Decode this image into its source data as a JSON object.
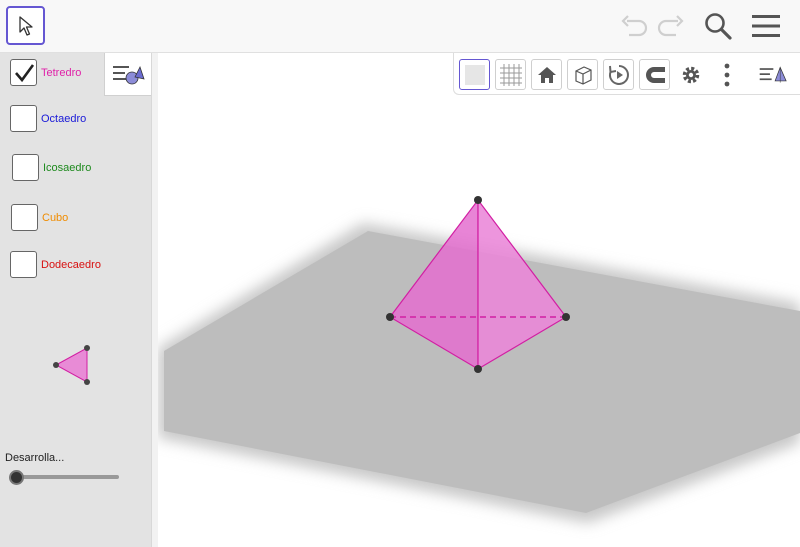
{
  "toolbar": {
    "move_tool": "move-tool",
    "undo": "undo-icon",
    "redo": "redo-icon",
    "search": "search-icon",
    "menu": "menu-icon"
  },
  "algebra": {
    "items": [
      {
        "label": "Tetredro",
        "checked": true,
        "color": "#e020a8"
      },
      {
        "label": "Octaedro",
        "checked": false,
        "color": "#1a1ad8"
      },
      {
        "label": "Icosaedro",
        "checked": false,
        "color": "#1e8a1e"
      },
      {
        "label": "Cubo",
        "checked": false,
        "color": "#f08c00"
      },
      {
        "label": "Dodecaedro",
        "checked": false,
        "color": "#d81010"
      }
    ],
    "slider": {
      "label": "Desarrolla...",
      "value": 0
    }
  },
  "stylebar": {
    "buttons": [
      "axes-icon",
      "grid-icon",
      "home-icon",
      "view-cube-icon",
      "rotate-icon",
      "magnet-icon",
      "gear-icon",
      "more-icon",
      "style-toggle-icon"
    ]
  },
  "colors": {
    "accent": "#6557d2",
    "tetrahedron_fill": "#e46fcf",
    "tetrahedron_edge": "#d21fa3",
    "plane": "#bdbdbd"
  }
}
